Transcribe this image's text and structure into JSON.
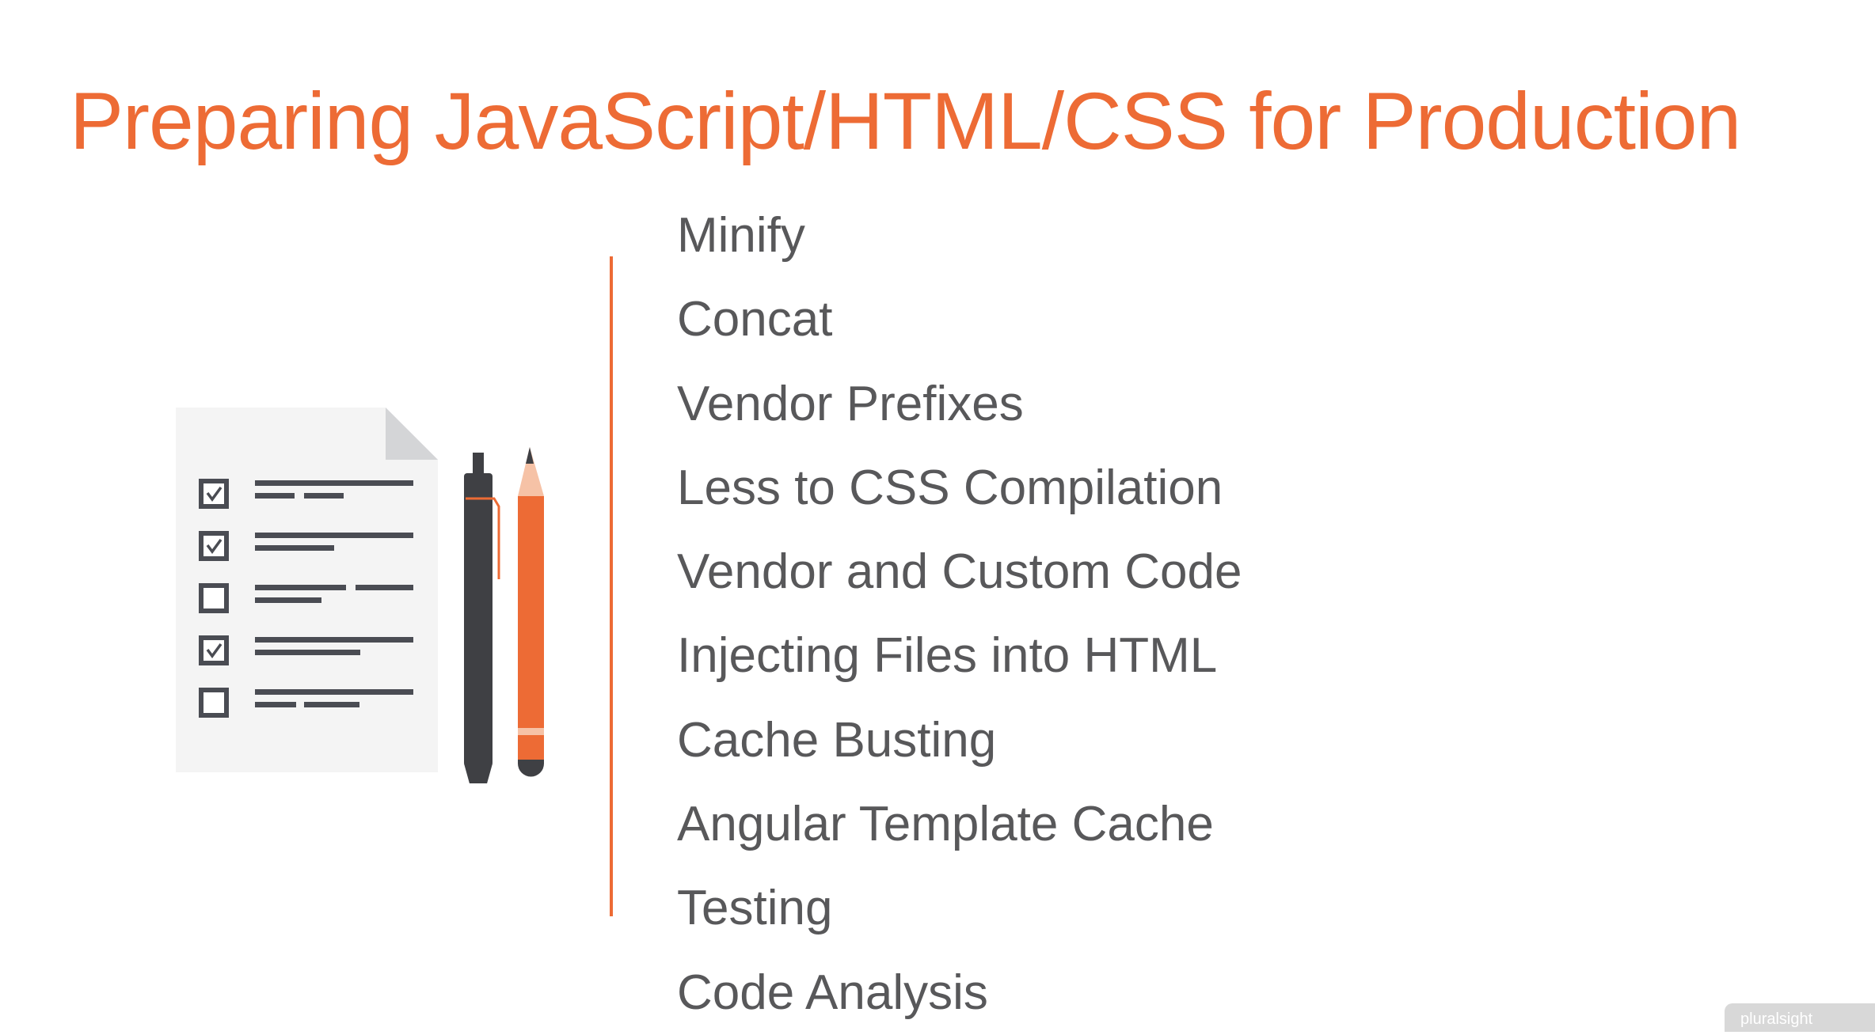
{
  "slide": {
    "title": "Preparing JavaScript/HTML/CSS for Production",
    "items": [
      "Minify",
      "Concat",
      "Vendor Prefixes",
      "Less to CSS Compilation",
      "Vendor and Custom Code",
      "Injecting Files into HTML",
      "Cache Busting",
      "Angular Template Cache",
      "Testing",
      "Code Analysis"
    ]
  },
  "illustration": {
    "icon": "checklist-with-pen-and-pencil",
    "checkboxes": [
      true,
      true,
      false,
      true,
      false
    ]
  },
  "watermark": {
    "text": "pluralsight"
  },
  "colors": {
    "accent": "#ed6b35",
    "text": "#58585a",
    "icon_dark": "#4a4c53",
    "paper": "#f4f4f4"
  }
}
